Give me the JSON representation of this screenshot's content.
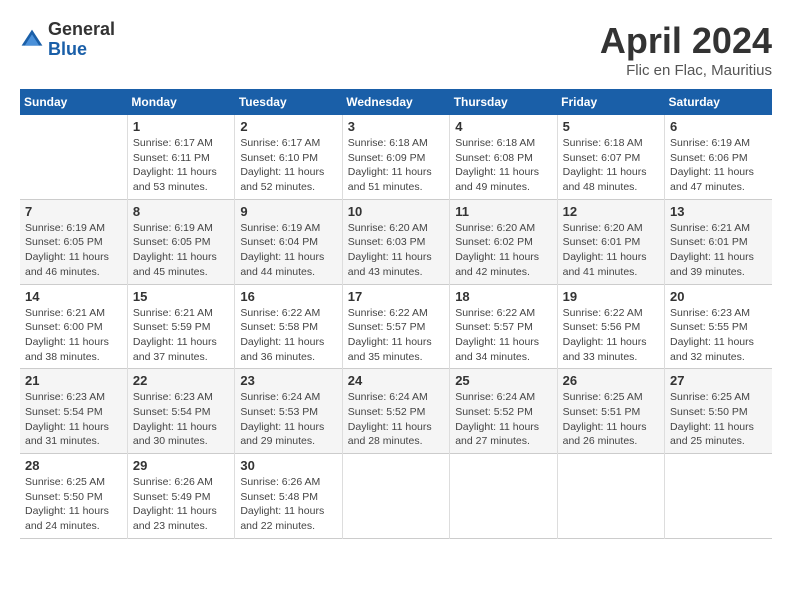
{
  "header": {
    "logo_general": "General",
    "logo_blue": "Blue",
    "month_title": "April 2024",
    "location": "Flic en Flac, Mauritius"
  },
  "days_of_week": [
    "Sunday",
    "Monday",
    "Tuesday",
    "Wednesday",
    "Thursday",
    "Friday",
    "Saturday"
  ],
  "weeks": [
    [
      {
        "day": "",
        "sunrise": "",
        "sunset": "",
        "daylight": "",
        "empty": true
      },
      {
        "day": "1",
        "sunrise": "Sunrise: 6:17 AM",
        "sunset": "Sunset: 6:11 PM",
        "daylight": "Daylight: 11 hours and 53 minutes."
      },
      {
        "day": "2",
        "sunrise": "Sunrise: 6:17 AM",
        "sunset": "Sunset: 6:10 PM",
        "daylight": "Daylight: 11 hours and 52 minutes."
      },
      {
        "day": "3",
        "sunrise": "Sunrise: 6:18 AM",
        "sunset": "Sunset: 6:09 PM",
        "daylight": "Daylight: 11 hours and 51 minutes."
      },
      {
        "day": "4",
        "sunrise": "Sunrise: 6:18 AM",
        "sunset": "Sunset: 6:08 PM",
        "daylight": "Daylight: 11 hours and 49 minutes."
      },
      {
        "day": "5",
        "sunrise": "Sunrise: 6:18 AM",
        "sunset": "Sunset: 6:07 PM",
        "daylight": "Daylight: 11 hours and 48 minutes."
      },
      {
        "day": "6",
        "sunrise": "Sunrise: 6:19 AM",
        "sunset": "Sunset: 6:06 PM",
        "daylight": "Daylight: 11 hours and 47 minutes."
      }
    ],
    [
      {
        "day": "7",
        "sunrise": "Sunrise: 6:19 AM",
        "sunset": "Sunset: 6:05 PM",
        "daylight": "Daylight: 11 hours and 46 minutes."
      },
      {
        "day": "8",
        "sunrise": "Sunrise: 6:19 AM",
        "sunset": "Sunset: 6:05 PM",
        "daylight": "Daylight: 11 hours and 45 minutes."
      },
      {
        "day": "9",
        "sunrise": "Sunrise: 6:19 AM",
        "sunset": "Sunset: 6:04 PM",
        "daylight": "Daylight: 11 hours and 44 minutes."
      },
      {
        "day": "10",
        "sunrise": "Sunrise: 6:20 AM",
        "sunset": "Sunset: 6:03 PM",
        "daylight": "Daylight: 11 hours and 43 minutes."
      },
      {
        "day": "11",
        "sunrise": "Sunrise: 6:20 AM",
        "sunset": "Sunset: 6:02 PM",
        "daylight": "Daylight: 11 hours and 42 minutes."
      },
      {
        "day": "12",
        "sunrise": "Sunrise: 6:20 AM",
        "sunset": "Sunset: 6:01 PM",
        "daylight": "Daylight: 11 hours and 41 minutes."
      },
      {
        "day": "13",
        "sunrise": "Sunrise: 6:21 AM",
        "sunset": "Sunset: 6:01 PM",
        "daylight": "Daylight: 11 hours and 39 minutes."
      }
    ],
    [
      {
        "day": "14",
        "sunrise": "Sunrise: 6:21 AM",
        "sunset": "Sunset: 6:00 PM",
        "daylight": "Daylight: 11 hours and 38 minutes."
      },
      {
        "day": "15",
        "sunrise": "Sunrise: 6:21 AM",
        "sunset": "Sunset: 5:59 PM",
        "daylight": "Daylight: 11 hours and 37 minutes."
      },
      {
        "day": "16",
        "sunrise": "Sunrise: 6:22 AM",
        "sunset": "Sunset: 5:58 PM",
        "daylight": "Daylight: 11 hours and 36 minutes."
      },
      {
        "day": "17",
        "sunrise": "Sunrise: 6:22 AM",
        "sunset": "Sunset: 5:57 PM",
        "daylight": "Daylight: 11 hours and 35 minutes."
      },
      {
        "day": "18",
        "sunrise": "Sunrise: 6:22 AM",
        "sunset": "Sunset: 5:57 PM",
        "daylight": "Daylight: 11 hours and 34 minutes."
      },
      {
        "day": "19",
        "sunrise": "Sunrise: 6:22 AM",
        "sunset": "Sunset: 5:56 PM",
        "daylight": "Daylight: 11 hours and 33 minutes."
      },
      {
        "day": "20",
        "sunrise": "Sunrise: 6:23 AM",
        "sunset": "Sunset: 5:55 PM",
        "daylight": "Daylight: 11 hours and 32 minutes."
      }
    ],
    [
      {
        "day": "21",
        "sunrise": "Sunrise: 6:23 AM",
        "sunset": "Sunset: 5:54 PM",
        "daylight": "Daylight: 11 hours and 31 minutes."
      },
      {
        "day": "22",
        "sunrise": "Sunrise: 6:23 AM",
        "sunset": "Sunset: 5:54 PM",
        "daylight": "Daylight: 11 hours and 30 minutes."
      },
      {
        "day": "23",
        "sunrise": "Sunrise: 6:24 AM",
        "sunset": "Sunset: 5:53 PM",
        "daylight": "Daylight: 11 hours and 29 minutes."
      },
      {
        "day": "24",
        "sunrise": "Sunrise: 6:24 AM",
        "sunset": "Sunset: 5:52 PM",
        "daylight": "Daylight: 11 hours and 28 minutes."
      },
      {
        "day": "25",
        "sunrise": "Sunrise: 6:24 AM",
        "sunset": "Sunset: 5:52 PM",
        "daylight": "Daylight: 11 hours and 27 minutes."
      },
      {
        "day": "26",
        "sunrise": "Sunrise: 6:25 AM",
        "sunset": "Sunset: 5:51 PM",
        "daylight": "Daylight: 11 hours and 26 minutes."
      },
      {
        "day": "27",
        "sunrise": "Sunrise: 6:25 AM",
        "sunset": "Sunset: 5:50 PM",
        "daylight": "Daylight: 11 hours and 25 minutes."
      }
    ],
    [
      {
        "day": "28",
        "sunrise": "Sunrise: 6:25 AM",
        "sunset": "Sunset: 5:50 PM",
        "daylight": "Daylight: 11 hours and 24 minutes."
      },
      {
        "day": "29",
        "sunrise": "Sunrise: 6:26 AM",
        "sunset": "Sunset: 5:49 PM",
        "daylight": "Daylight: 11 hours and 23 minutes."
      },
      {
        "day": "30",
        "sunrise": "Sunrise: 6:26 AM",
        "sunset": "Sunset: 5:48 PM",
        "daylight": "Daylight: 11 hours and 22 minutes."
      },
      {
        "day": "",
        "sunrise": "",
        "sunset": "",
        "daylight": "",
        "empty": true
      },
      {
        "day": "",
        "sunrise": "",
        "sunset": "",
        "daylight": "",
        "empty": true
      },
      {
        "day": "",
        "sunrise": "",
        "sunset": "",
        "daylight": "",
        "empty": true
      },
      {
        "day": "",
        "sunrise": "",
        "sunset": "",
        "daylight": "",
        "empty": true
      }
    ]
  ]
}
